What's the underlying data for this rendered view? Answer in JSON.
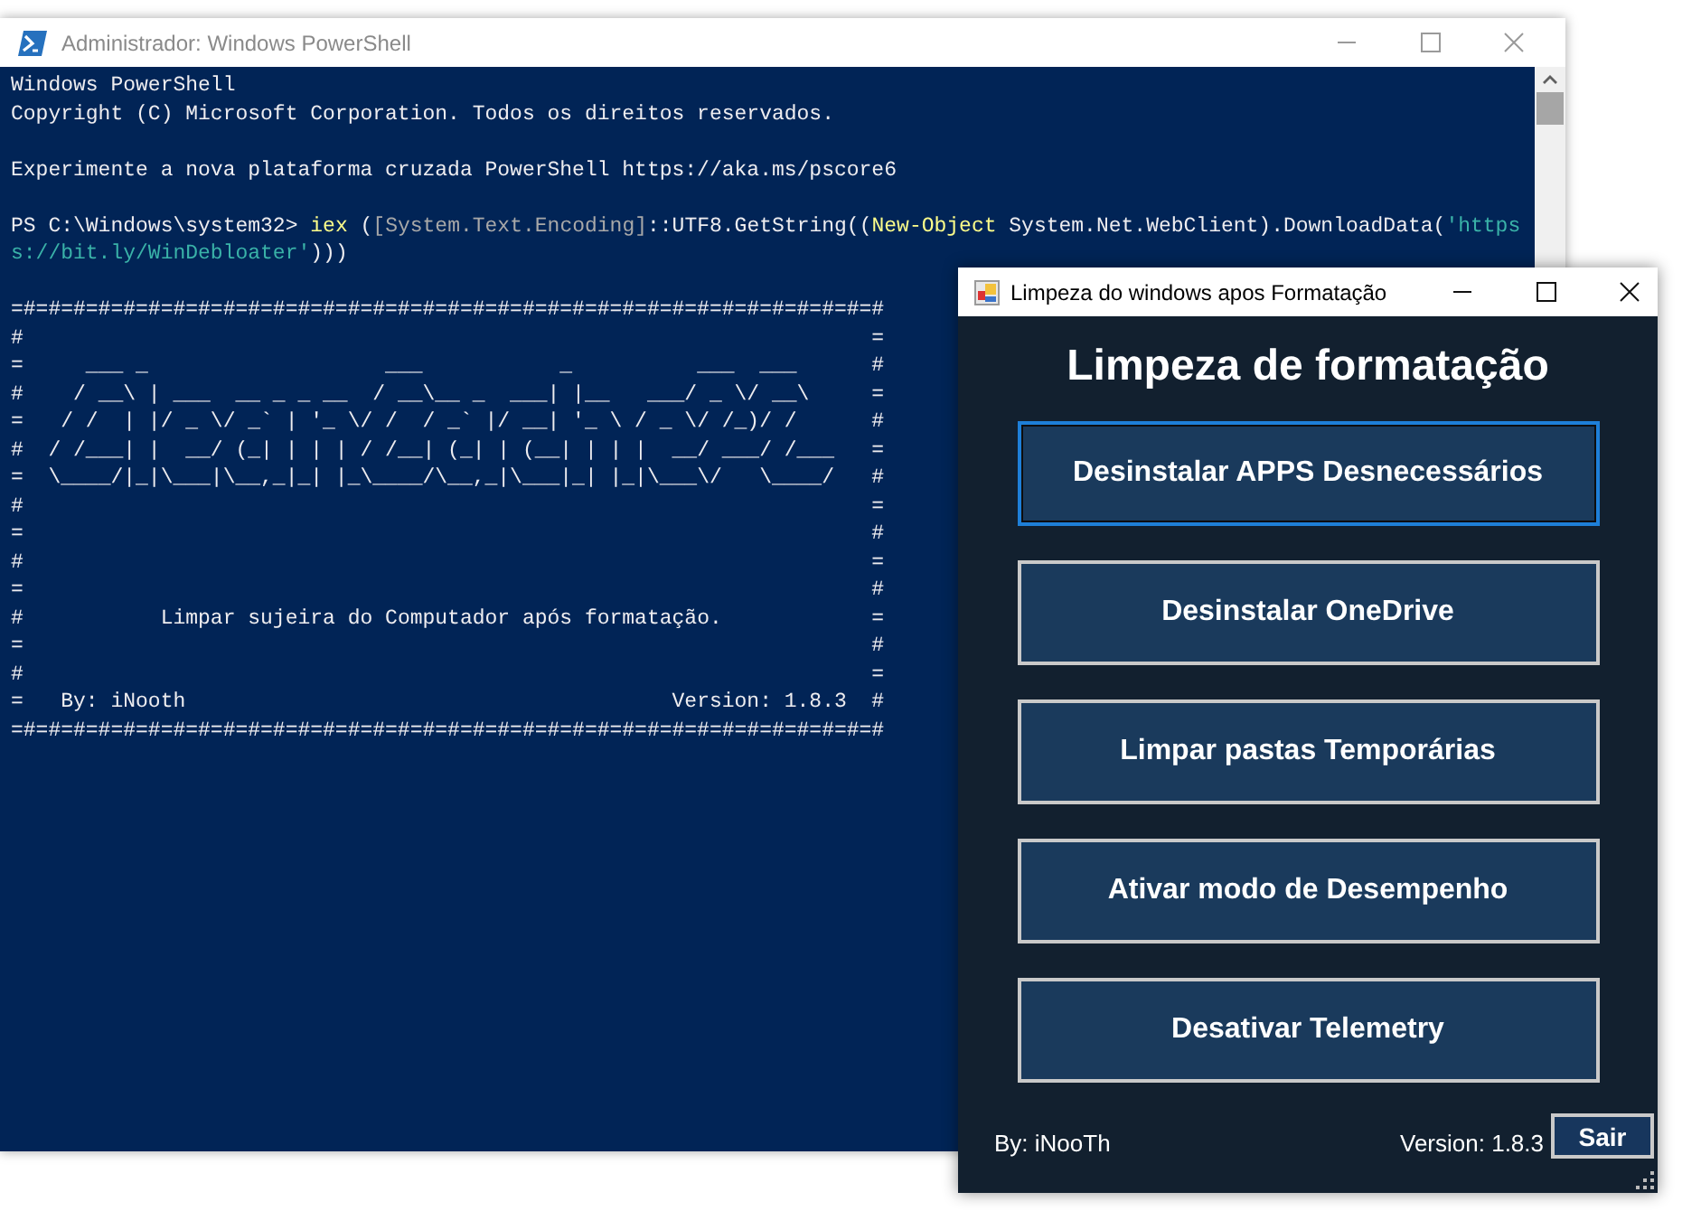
{
  "powershell_window": {
    "title": "Administrador: Windows PowerShell",
    "lines": [
      {
        "kind": "text",
        "segments": [
          {
            "kind": "plain",
            "text": "Windows PowerShell"
          }
        ]
      },
      {
        "kind": "text",
        "segments": [
          {
            "kind": "plain",
            "text": "Copyright (C) Microsoft Corporation. Todos os direitos reservados."
          }
        ]
      },
      {
        "kind": "blank"
      },
      {
        "kind": "text",
        "segments": [
          {
            "kind": "plain",
            "text": "Experimente a nova plataforma cruzada PowerShell https://aka.ms/pscore6"
          }
        ]
      },
      {
        "kind": "blank"
      },
      {
        "kind": "text",
        "segments": [
          {
            "kind": "plain",
            "text": "PS C:\\Windows\\system32> "
          },
          {
            "kind": "command",
            "text": "iex"
          },
          {
            "kind": "plain",
            "text": " ("
          },
          {
            "kind": "type",
            "text": "[System.Text.Encoding]"
          },
          {
            "kind": "plain",
            "text": "::UTF8.GetString(("
          },
          {
            "kind": "command",
            "text": "New-Object"
          },
          {
            "kind": "plain",
            "text": " System.Net.WebClient).DownloadData("
          },
          {
            "kind": "string",
            "text": "'https"
          }
        ]
      },
      {
        "kind": "text",
        "segments": [
          {
            "kind": "string",
            "text": "s://bit.ly/WinDebloater'"
          },
          {
            "kind": "plain",
            "text": ")))"
          }
        ]
      },
      {
        "kind": "blank"
      },
      {
        "kind": "border",
        "text": "=#=#=#=#=#=#=#=#=#=#=#=#=#=#=#=#=#=#=#=#=#=#=#=#=#=#=#=#=#=#=#=#=#=#=#"
      },
      {
        "kind": "frame",
        "left": "#",
        "right": "="
      },
      {
        "kind": "frame",
        "left": "=",
        "content": "     ___ _                   ___           _          ___  ___",
        "right": "#"
      },
      {
        "kind": "frame",
        "left": "#",
        "content": "    / __\\ | ___  __ _ _ __  / __\\__ _  ___| |__   ___/ _ \\/ __\\",
        "right": "="
      },
      {
        "kind": "frame",
        "left": "=",
        "content": "   / /  | |/ _ \\/ _` | '_ \\/ /  / _` |/ __| '_ \\ / _ \\/ /_)/ /",
        "right": "#"
      },
      {
        "kind": "frame",
        "left": "#",
        "content": "  / /___| |  __/ (_| | | | / /__| (_| | (__| | | |  __/ ___/ /___",
        "right": "="
      },
      {
        "kind": "frame",
        "left": "=",
        "content": "  \\____/|_|\\___|\\__,_|_| |_\\____/\\__,_|\\___|_| |_|\\___\\/   \\____/",
        "right": "#"
      },
      {
        "kind": "frame",
        "left": "#",
        "right": "="
      },
      {
        "kind": "frame",
        "left": "=",
        "right": "#"
      },
      {
        "kind": "frame",
        "left": "#",
        "right": "="
      },
      {
        "kind": "frame",
        "left": "=",
        "right": "#"
      },
      {
        "kind": "frame",
        "left": "#",
        "content": "           Limpar sujeira do Computador após formatação.",
        "right": "="
      },
      {
        "kind": "frame",
        "left": "=",
        "right": "#"
      },
      {
        "kind": "frame",
        "left": "#",
        "right": "="
      },
      {
        "kind": "frame",
        "left": "=",
        "content": "   By: iNooth                                       Version: 1.8.3",
        "right": "#"
      },
      {
        "kind": "border",
        "text": "=#=#=#=#=#=#=#=#=#=#=#=#=#=#=#=#=#=#=#=#=#=#=#=#=#=#=#=#=#=#=#=#=#=#=#"
      }
    ]
  },
  "form_window": {
    "title": "Limpeza do windows apos Formatação",
    "heading": "Limpeza de formatação",
    "buttons": [
      {
        "label": "Desinstalar APPS Desnecessários",
        "focused": true
      },
      {
        "label": "Desinstalar OneDrive",
        "focused": false
      },
      {
        "label": "Limpar pastas Temporárias",
        "focused": false
      },
      {
        "label": "Ativar modo de Desempenho",
        "focused": false
      },
      {
        "label": "Desativar Telemetry",
        "focused": false
      }
    ],
    "author": "By: iNooTh",
    "version": "Version: 1.8.3",
    "exit_button": "Sair"
  }
}
